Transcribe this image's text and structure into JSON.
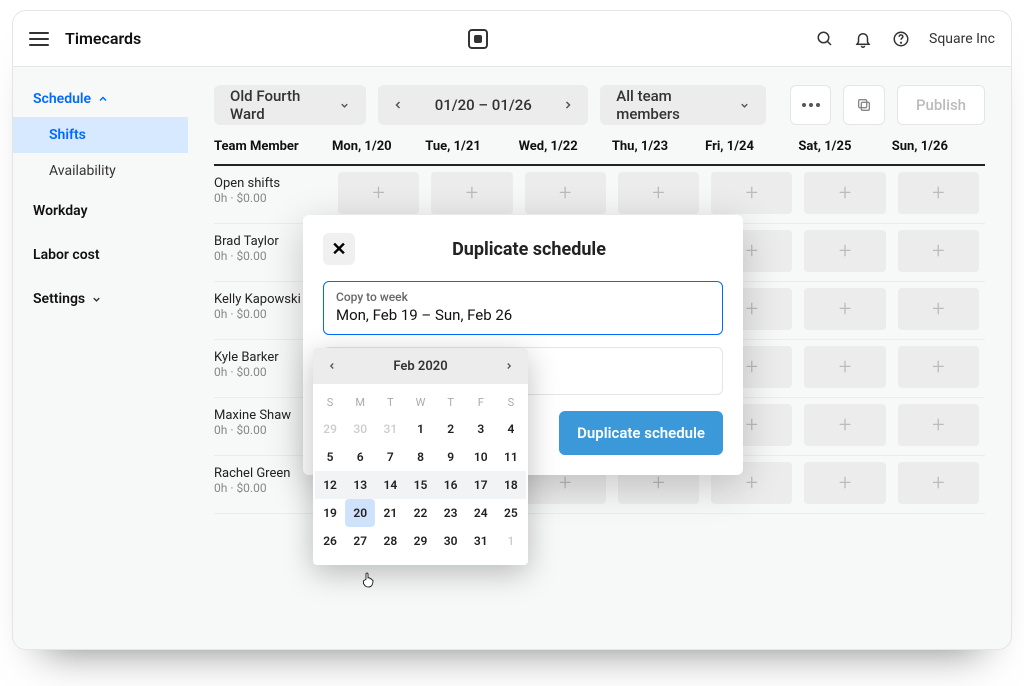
{
  "header": {
    "page_title": "Timecards",
    "org_name": "Square Inc"
  },
  "sidebar": {
    "head": "Schedule",
    "items": [
      {
        "label": "Shifts",
        "active": true
      },
      {
        "label": "Availability",
        "active": false
      }
    ],
    "groups": [
      {
        "label": "Workday"
      },
      {
        "label": "Labor cost"
      },
      {
        "label": "Settings",
        "expandable": true
      }
    ]
  },
  "toolbar": {
    "location": "Old Fourth Ward",
    "date_range": "01/20 – 01/26",
    "team_filter": "All team members",
    "publish_label": "Publish"
  },
  "grid": {
    "columns": [
      "Team Member",
      "Mon, 1/20",
      "Tue, 1/21",
      "Wed, 1/22",
      "Thu, 1/23",
      "Fri, 1/24",
      "Sat, 1/25",
      "Sun, 1/26"
    ],
    "rows": [
      {
        "name": "Open shifts",
        "meta": "0h · $0.00"
      },
      {
        "name": "Brad Taylor",
        "meta": "0h · $0.00"
      },
      {
        "name": "Kelly Kapowski",
        "meta": "0h · $0.00"
      },
      {
        "name": "Kyle Barker",
        "meta": "0h · $0.00"
      },
      {
        "name": "Maxine Shaw",
        "meta": "0h · $0.00"
      },
      {
        "name": "Rachel Green",
        "meta": "0h · $0.00"
      }
    ]
  },
  "modal": {
    "title": "Duplicate schedule",
    "field_label": "Copy to week",
    "field_value": "Mon, Feb 19 – Sun, Feb 26",
    "action_label": "Duplicate schedule"
  },
  "datepicker": {
    "month_label": "Feb 2020",
    "dow": [
      "S",
      "M",
      "T",
      "W",
      "T",
      "F",
      "S"
    ],
    "weeks": [
      [
        {
          "d": "29",
          "muted": true
        },
        {
          "d": "30",
          "muted": true
        },
        {
          "d": "31",
          "muted": true
        },
        {
          "d": "1"
        },
        {
          "d": "2"
        },
        {
          "d": "3"
        },
        {
          "d": "4"
        }
      ],
      [
        {
          "d": "5"
        },
        {
          "d": "6"
        },
        {
          "d": "7"
        },
        {
          "d": "8"
        },
        {
          "d": "9"
        },
        {
          "d": "10"
        },
        {
          "d": "11"
        }
      ],
      [
        {
          "d": "12",
          "inrange": true
        },
        {
          "d": "13",
          "inrange": true
        },
        {
          "d": "14",
          "inrange": true
        },
        {
          "d": "15",
          "inrange": true
        },
        {
          "d": "16",
          "inrange": true
        },
        {
          "d": "17",
          "inrange": true
        },
        {
          "d": "18",
          "inrange": true
        }
      ],
      [
        {
          "d": "19"
        },
        {
          "d": "20",
          "selected": true
        },
        {
          "d": "21"
        },
        {
          "d": "22"
        },
        {
          "d": "23"
        },
        {
          "d": "24"
        },
        {
          "d": "25"
        }
      ],
      [
        {
          "d": "26"
        },
        {
          "d": "27"
        },
        {
          "d": "28"
        },
        {
          "d": "29"
        },
        {
          "d": "30"
        },
        {
          "d": "31"
        },
        {
          "d": "1",
          "muted": true
        }
      ]
    ]
  }
}
